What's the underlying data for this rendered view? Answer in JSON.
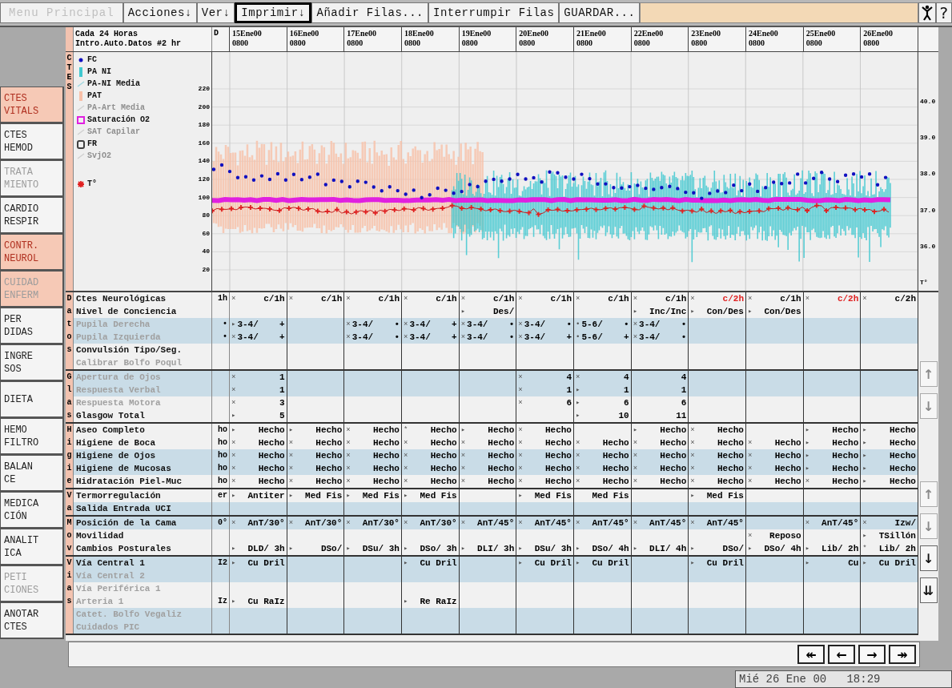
{
  "toolbar": {
    "buttons": [
      {
        "label": "Menu Principal",
        "disabled": true,
        "focused": false
      },
      {
        "label": "Acciones↓",
        "disabled": false,
        "focused": false
      },
      {
        "label": "Ver↓",
        "disabled": false,
        "focused": false
      },
      {
        "label": "Imprimir↓",
        "disabled": false,
        "focused": true
      },
      {
        "label": "Añadir Filas...",
        "disabled": false,
        "focused": false
      },
      {
        "label": "Interrumpir Filas",
        "disabled": false,
        "focused": false
      },
      {
        "label": "GUARDAR...",
        "disabled": false,
        "focused": false
      }
    ],
    "help": "?"
  },
  "sidebar": [
    {
      "lines": [
        "CTES",
        "VITALS"
      ],
      "selected": true,
      "disabled": false
    },
    {
      "lines": [
        "CTES",
        "HEMOD"
      ],
      "selected": false,
      "disabled": false
    },
    {
      "lines": [
        "TRATA",
        "MIENTO"
      ],
      "selected": false,
      "disabled": true
    },
    {
      "lines": [
        "CARDIO",
        "RESPIR"
      ],
      "selected": false,
      "disabled": false
    },
    {
      "lines": [
        "CONTR.",
        "NEUROL"
      ],
      "selected": true,
      "disabled": false
    },
    {
      "lines": [
        "CUIDAD",
        "ENFERM"
      ],
      "selected": true,
      "disabled": true
    },
    {
      "lines": [
        "PER",
        "DIDAS"
      ],
      "selected": false,
      "disabled": false
    },
    {
      "lines": [
        "INGRE",
        "SOS"
      ],
      "selected": false,
      "disabled": false
    },
    {
      "lines": [
        "DIETA"
      ],
      "selected": false,
      "disabled": false
    },
    {
      "lines": [
        "HEMO",
        "FILTRO"
      ],
      "selected": false,
      "disabled": false
    },
    {
      "lines": [
        "BALAN",
        "CE"
      ],
      "selected": false,
      "disabled": false
    },
    {
      "lines": [
        "MEDICA",
        "CIÓN"
      ],
      "selected": false,
      "disabled": false
    },
    {
      "lines": [
        "ANALIT",
        "ICA"
      ],
      "selected": false,
      "disabled": false
    },
    {
      "lines": [
        "PETI",
        "CIONES"
      ],
      "selected": false,
      "disabled": true
    },
    {
      "lines": [
        "ANOTAR",
        "CTES"
      ],
      "selected": false,
      "disabled": false
    }
  ],
  "header": {
    "lines": [
      "Cada 24 Horas",
      "Intro.Auto.Datos #2 hr"
    ],
    "d_label": "D",
    "dates": [
      {
        "date": "15Ene00",
        "time": "0800"
      },
      {
        "date": "16Ene00",
        "time": "0800"
      },
      {
        "date": "17Ene00",
        "time": "0800"
      },
      {
        "date": "18Ene00",
        "time": "0800"
      },
      {
        "date": "19Ene00",
        "time": "0800"
      },
      {
        "date": "20Ene00",
        "time": "0800"
      },
      {
        "date": "21Ene00",
        "time": "0800"
      },
      {
        "date": "22Ene00",
        "time": "0800"
      },
      {
        "date": "23Ene00",
        "time": "0800"
      },
      {
        "date": "24Ene00",
        "time": "0800"
      },
      {
        "date": "25Ene00",
        "time": "0800"
      },
      {
        "date": "26Ene00",
        "time": "0800"
      }
    ]
  },
  "chart": {
    "letters": [
      "C",
      "T",
      "E",
      "S"
    ],
    "legend": [
      {
        "label": "FC",
        "kind": "dot",
        "color": "#1010c0",
        "dim": false
      },
      {
        "label": "PA NI",
        "kind": "bar",
        "color": "#40c8d0",
        "dim": false
      },
      {
        "label": "PA-NI Media",
        "kind": "line",
        "color": "#a0d8e0",
        "dim": false
      },
      {
        "label": "PAT",
        "kind": "bar",
        "color": "#f8c0a8",
        "dim": false
      },
      {
        "label": "PA-Art Media",
        "kind": "line",
        "color": "#d0d0d0",
        "dim": true
      },
      {
        "label": "Saturación O2",
        "kind": "square",
        "color": "#e020e0",
        "dim": false
      },
      {
        "label": "SAT Capilar",
        "kind": "line",
        "color": "#d0d0d0",
        "dim": true
      },
      {
        "label": "FR",
        "kind": "box",
        "color": "#404040",
        "dim": false
      },
      {
        "label": "SvjO2",
        "kind": "line",
        "color": "#d0d0d0",
        "dim": true
      },
      {
        "label": "T°",
        "kind": "star",
        "color": "#e02020",
        "dim": false
      }
    ],
    "left_ticks": [
      "220",
      "200",
      "180",
      "160",
      "140",
      "120",
      "100",
      "80",
      "60",
      "40",
      "20"
    ],
    "right_ticks": [
      "40.0",
      "39.0",
      "38.0",
      "37.0",
      "36.0",
      "T°"
    ]
  },
  "sections": [
    {
      "rows": [
        {
          "letter": "D",
          "label": "Ctes Neurológicas",
          "dim": false,
          "shaded": false,
          "cells": [
            "1h",
            {
              "mark": "×",
              "value": "c/1h",
              "alert": false
            },
            {
              "mark": "×",
              "value": "c/1h",
              "alert": false
            },
            {
              "mark": "×",
              "value": "c/1h",
              "alert": false
            },
            {
              "mark": "×",
              "value": "c/1h",
              "alert": false
            },
            {
              "mark": "×",
              "value": "c/1h",
              "alert": false
            },
            {
              "mark": "×",
              "value": "c/1h",
              "alert": false
            },
            {
              "mark": "×",
              "value": "c/1h",
              "alert": false
            },
            {
              "mark": "×",
              "value": "c/1h",
              "alert": false
            },
            {
              "mark": "×",
              "value": "c/2h",
              "alert": true
            },
            {
              "mark": "×",
              "value": "c/1h",
              "alert": false
            },
            {
              "mark": "×",
              "value": "c/2h",
              "alert": true
            },
            {
              "mark": "×",
              "value": "c/2h",
              "alert": false
            }
          ]
        },
        {
          "letter": "a",
          "label": "Nivel de Conciencia",
          "dim": false,
          "shaded": false,
          "cells": [
            null,
            null,
            null,
            null,
            null,
            [
              "▸",
              "Des/"
            ],
            null,
            null,
            [
              "▸",
              "Inc/Inc"
            ],
            [
              "▸",
              "Con/Des"
            ],
            [
              "▸",
              "Con/Des"
            ],
            null,
            null
          ]
        },
        {
          "letter": "t",
          "label": "Pupila Derecha",
          "dim": true,
          "shaded": true,
          "cells": [
            "•",
            [
              "▸",
              "3-4/",
              "+"
            ],
            null,
            [
              "×",
              "3-4/",
              "•"
            ],
            [
              "×",
              "3-4/",
              "+"
            ],
            [
              "×",
              "3-4/",
              "•"
            ],
            [
              "×",
              "3-4/",
              "•"
            ],
            [
              "•",
              "5-6/",
              "•"
            ],
            [
              "×",
              "3-4/",
              "•"
            ],
            null,
            null,
            null,
            null
          ]
        },
        {
          "letter": "o",
          "label": "Pupila Izquierda",
          "dim": true,
          "shaded": true,
          "cells": [
            "•",
            [
              "×",
              "3-4/",
              "+"
            ],
            null,
            [
              "×",
              "3-4/",
              "•"
            ],
            [
              "×",
              "3-4/",
              "+"
            ],
            [
              "×",
              "3-4/",
              "•"
            ],
            [
              "×",
              "3-4/",
              "+"
            ],
            [
              "•",
              "5-6/",
              "+"
            ],
            [
              "×",
              "3-4/",
              "•"
            ],
            null,
            null,
            null,
            null
          ]
        },
        {
          "letter": "s",
          "label": "Convulsión Tipo/Seg.",
          "dim": false,
          "shaded": false,
          "cells": [
            null,
            null,
            null,
            null,
            null,
            null,
            null,
            null,
            null,
            null,
            null,
            null,
            null
          ]
        },
        {
          "label": "Calibrar Bolfo Poqul",
          "dim": true,
          "shaded": false,
          "cells": [
            null,
            null,
            null,
            null,
            null,
            null,
            null,
            null,
            null,
            null,
            null,
            null,
            null
          ]
        }
      ]
    },
    {
      "rows": [
        {
          "letter": "G",
          "label": "Apertura de Ojos",
          "dim": true,
          "shaded": true,
          "cells": [
            null,
            [
              "×",
              "1"
            ],
            null,
            null,
            null,
            null,
            [
              "×",
              "4"
            ],
            [
              "×",
              "4"
            ],
            [
              null,
              "4"
            ],
            null,
            null,
            null,
            null
          ]
        },
        {
          "letter": "l",
          "label": "Respuesta Verbal",
          "dim": true,
          "shaded": true,
          "cells": [
            null,
            [
              "×",
              "1"
            ],
            null,
            null,
            null,
            null,
            [
              "×",
              "1"
            ],
            [
              "▸",
              "1"
            ],
            [
              null,
              "1"
            ],
            null,
            null,
            null,
            null
          ]
        },
        {
          "letter": "a",
          "label": "Respuesta Motora",
          "dim": true,
          "shaded": false,
          "cells": [
            null,
            [
              "×",
              "3"
            ],
            null,
            null,
            null,
            null,
            [
              "×",
              "6"
            ],
            [
              "▸",
              "6"
            ],
            [
              null,
              "6"
            ],
            null,
            null,
            null,
            null
          ]
        },
        {
          "letter": "s",
          "label": "Glasgow Total",
          "dim": false,
          "shaded": false,
          "cells": [
            null,
            [
              "▸",
              "5"
            ],
            null,
            null,
            null,
            null,
            null,
            [
              "▸",
              "10"
            ],
            [
              null,
              "11"
            ],
            null,
            null,
            null,
            null
          ]
        }
      ]
    },
    {
      "rows": [
        {
          "letter": "H",
          "label": "Aseo Completo",
          "dim": false,
          "shaded": false,
          "cells": [
            "ho",
            [
              "▸",
              "Hecho"
            ],
            [
              "▸",
              "Hecho"
            ],
            [
              "×",
              "Hecho"
            ],
            [
              "*",
              "Hecho"
            ],
            [
              "▸",
              "Hecho"
            ],
            [
              "×",
              "Hecho"
            ],
            null,
            [
              "▸",
              "Hecho"
            ],
            [
              "×",
              "Hecho"
            ],
            null,
            [
              "▸",
              "Hecho"
            ],
            [
              "▸",
              "Hecho"
            ]
          ]
        },
        {
          "letter": "i",
          "label": "Higiene de Boca",
          "dim": false,
          "shaded": false,
          "cells": [
            "ho",
            [
              "×",
              "Hecho"
            ],
            [
              "×",
              "Hecho"
            ],
            [
              "×",
              "Hecho"
            ],
            [
              "×",
              "Hecho"
            ],
            [
              "×",
              "Hecho"
            ],
            [
              "×",
              "Hecho"
            ],
            [
              "×",
              "Hecho"
            ],
            [
              "×",
              "Hecho"
            ],
            [
              "×",
              "Hecho"
            ],
            [
              "×",
              "Hecho"
            ],
            [
              "▸",
              "Hecho"
            ],
            [
              "▸",
              "Hecho"
            ]
          ]
        },
        {
          "letter": "g",
          "label": "Higiene de Ojos",
          "dim": false,
          "shaded": true,
          "cells": [
            "ho",
            [
              "×",
              "Hecho"
            ],
            [
              "×",
              "Hecho"
            ],
            [
              "×",
              "Hecho"
            ],
            [
              "×",
              "Hecho"
            ],
            [
              "×",
              "Hecho"
            ],
            [
              "×",
              "Hecho"
            ],
            [
              "×",
              "Hecho"
            ],
            [
              "×",
              "Hecho"
            ],
            [
              "×",
              "Hecho"
            ],
            [
              "×",
              "Hecho"
            ],
            [
              "▸",
              "Hecho"
            ],
            [
              "▸",
              "Hecho"
            ]
          ]
        },
        {
          "letter": "i",
          "label": "Higiene de Mucosas",
          "dim": false,
          "shaded": true,
          "cells": [
            "ho",
            [
              "×",
              "Hecho"
            ],
            [
              "×",
              "Hecho"
            ],
            [
              "×",
              "Hecho"
            ],
            [
              "×",
              "Hecho"
            ],
            [
              "×",
              "Hecho"
            ],
            [
              "×",
              "Hecho"
            ],
            [
              "×",
              "Hecho"
            ],
            [
              "×",
              "Hecho"
            ],
            [
              "×",
              "Hecho"
            ],
            [
              "×",
              "Hecho"
            ],
            [
              "▸",
              "Hecho"
            ],
            [
              "▸",
              "Hecho"
            ]
          ]
        },
        {
          "letter": "e",
          "label": "Hidratación Piel-Muc",
          "dim": false,
          "shaded": false,
          "cells": [
            "ho",
            [
              "×",
              "Hecho"
            ],
            [
              "×",
              "Hecho"
            ],
            [
              "×",
              "Hecho"
            ],
            [
              "×",
              "Hecho"
            ],
            [
              "×",
              "Hecho"
            ],
            [
              "×",
              "Hecho"
            ],
            [
              "×",
              "Hecho"
            ],
            [
              "×",
              "Hecho"
            ],
            [
              "×",
              "Hecho"
            ],
            [
              "×",
              "Hecho"
            ],
            [
              "×",
              "Hecho"
            ],
            [
              "▸",
              "Hecho"
            ]
          ]
        }
      ]
    },
    {
      "rows": [
        {
          "letter": "V",
          "label": "Termorregulación",
          "dim": false,
          "shaded": false,
          "cells": [
            "er",
            [
              "▸",
              "Antiter"
            ],
            [
              "▸",
              "Med Fis"
            ],
            [
              "▸",
              "Med Fis"
            ],
            [
              "▸",
              "Med Fis"
            ],
            null,
            [
              "▸",
              "Med Fis"
            ],
            [
              null,
              "Med Fis"
            ],
            null,
            [
              "▸",
              "Med Fis"
            ],
            null,
            null,
            null
          ]
        },
        {
          "letter": "a",
          "label": "Salida Entrada UCI",
          "dim": false,
          "shaded": true,
          "cells": [
            null,
            null,
            null,
            null,
            null,
            null,
            null,
            null,
            null,
            null,
            null,
            null,
            null
          ]
        }
      ]
    },
    {
      "rows": [
        {
          "letter": "M",
          "label": "Posición de la Cama",
          "dim": false,
          "shaded": true,
          "cells": [
            "0°",
            [
              "×",
              "AnT/30°"
            ],
            [
              "×",
              "AnT/30°"
            ],
            [
              "×",
              "AnT/30°"
            ],
            [
              "×",
              "AnT/30°"
            ],
            [
              "×",
              "AnT/45°"
            ],
            [
              "×",
              "AnT/45°"
            ],
            [
              "×",
              "AnT/45°"
            ],
            [
              "×",
              "AnT/45°"
            ],
            [
              "×",
              "AnT/45°"
            ],
            null,
            [
              "×",
              "AnT/45°"
            ],
            [
              "×",
              "Izw/"
            ]
          ]
        },
        {
          "letter": "o",
          "label": "Movilidad",
          "dim": false,
          "shaded": false,
          "cells": [
            null,
            null,
            null,
            null,
            null,
            null,
            null,
            null,
            null,
            null,
            [
              "×",
              "Reposo"
            ],
            null,
            [
              "▸",
              "TSillón"
            ]
          ]
        },
        {
          "letter": "v",
          "label": "Cambios Posturales",
          "dim": false,
          "shaded": false,
          "cells": [
            null,
            [
              "▸",
              "DLD/ 3h"
            ],
            [
              "▸",
              "DSo/"
            ],
            [
              "▸",
              "DSu/ 3h"
            ],
            [
              "▸",
              "DSo/ 3h"
            ],
            [
              "▸",
              "DLI/ 3h"
            ],
            [
              "▸",
              "DSu/ 3h"
            ],
            [
              "▸",
              "DSo/ 4h"
            ],
            [
              "▸",
              "DLI/ 4h"
            ],
            [
              "▸",
              "DSo/"
            ],
            [
              "▸",
              "DSo/ 4h"
            ],
            [
              "▸",
              "Lib/ 2h"
            ],
            [
              "*",
              "Lib/ 2h"
            ]
          ]
        }
      ]
    },
    {
      "rows": [
        {
          "letter": "V",
          "label": "Vía Central 1",
          "dim": false,
          "shaded": true,
          "cells": [
            "I2",
            [
              "▸",
              "Cu Dril"
            ],
            null,
            null,
            [
              "▸",
              "Cu Dril"
            ],
            null,
            [
              "▸",
              "Cu Dril"
            ],
            [
              "▸",
              "Cu Dril"
            ],
            null,
            [
              "▸",
              "Cu Dril"
            ],
            null,
            [
              "▸",
              "Cu"
            ],
            [
              "▸",
              "Cu Dril"
            ]
          ]
        },
        {
          "letter": "i",
          "label": "Vía Central 2",
          "dim": true,
          "shaded": true,
          "cells": [
            null,
            null,
            null,
            null,
            null,
            null,
            null,
            null,
            null,
            null,
            null,
            null,
            null
          ]
        },
        {
          "letter": "a",
          "label": "Vía Periférica 1",
          "dim": true,
          "shaded": false,
          "cells": [
            null,
            null,
            null,
            null,
            null,
            null,
            null,
            null,
            null,
            null,
            null,
            null,
            null
          ]
        },
        {
          "letter": "s",
          "label": "Arteria 1",
          "dim": true,
          "shaded": false,
          "cells": [
            "Iz",
            [
              "▸",
              "Cu RaIz"
            ],
            null,
            null,
            [
              "▸",
              "Re RaIz"
            ],
            null,
            null,
            null,
            null,
            null,
            null,
            null,
            null
          ]
        },
        {
          "label": "Catet. Bolfo Vegaliz",
          "dim": true,
          "shaded": true,
          "cells": [
            null,
            null,
            null,
            null,
            null,
            null,
            null,
            null,
            null,
            null,
            null,
            null,
            null
          ]
        },
        {
          "label": "Cuidados PIC",
          "dim": true,
          "shaded": true,
          "cells": [
            null,
            null,
            null,
            null,
            null,
            null,
            null,
            null,
            null,
            null,
            null,
            null,
            null
          ]
        }
      ]
    }
  ],
  "scroll_groups": [
    [
      {
        "label": "↑",
        "disabled": true
      },
      {
        "label": "↓",
        "disabled": true
      }
    ],
    [
      {
        "label": "↑",
        "disabled": true
      },
      {
        "label": "↓",
        "disabled": true
      },
      {
        "label": "↓",
        "disabled": false
      },
      {
        "label": "⇊",
        "disabled": false
      }
    ]
  ],
  "nav": [
    "↞",
    "←",
    "→",
    "↠"
  ],
  "status": {
    "clock": "Mié 26 Ene 00   18:29"
  }
}
